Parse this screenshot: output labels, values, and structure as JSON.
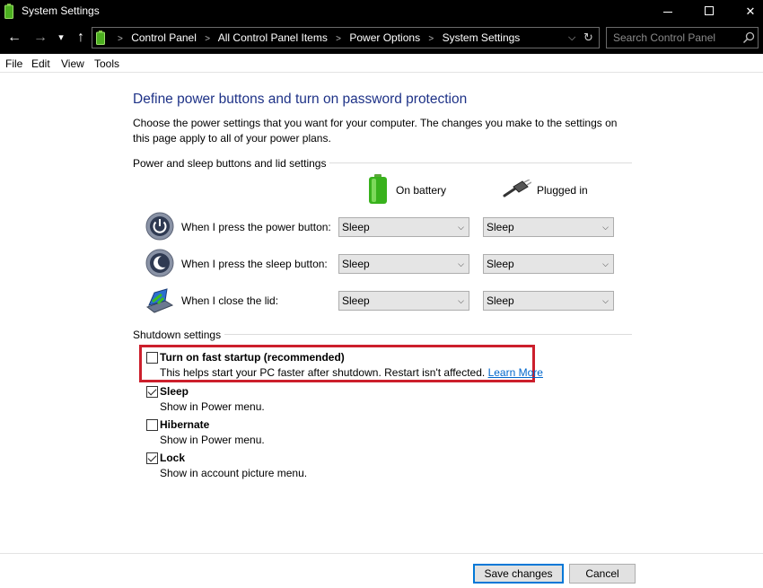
{
  "window": {
    "title": "System Settings",
    "min_icon": "minimize-icon",
    "max_icon": "maximize-icon",
    "close_glyph": "✕"
  },
  "address_bar": {
    "breadcrumbs": [
      "Control Panel",
      "All Control Panel Items",
      "Power Options",
      "System Settings"
    ],
    "search_placeholder": "Search Control Panel"
  },
  "menu": {
    "items": [
      "File",
      "Edit",
      "View",
      "Tools"
    ]
  },
  "content": {
    "heading": "Define power buttons and turn on password protection",
    "description": "Choose the power settings that you want for your computer. The changes you make to the settings on this page apply to all of your power plans.",
    "power_group_label": "Power and sleep buttons and lid settings",
    "columns": {
      "battery": "On battery",
      "plugged": "Plugged in"
    },
    "rows": [
      {
        "label": "When I press the power button:",
        "icon": "power-button-icon",
        "battery": "Sleep",
        "plugged": "Sleep"
      },
      {
        "label": "When I press the sleep button:",
        "icon": "sleep-button-icon",
        "battery": "Sleep",
        "plugged": "Sleep"
      },
      {
        "label": "When I close the lid:",
        "icon": "laptop-lid-icon",
        "battery": "Sleep",
        "plugged": "Sleep"
      }
    ],
    "shutdown_group_label": "Shutdown settings",
    "shutdown_options": [
      {
        "title": "Turn on fast startup (recommended)",
        "desc": "This helps start your PC faster after shutdown. Restart isn't affected.",
        "link": "Learn More",
        "checked": false
      },
      {
        "title": "Sleep",
        "desc": "Show in Power menu.",
        "checked": true
      },
      {
        "title": "Hibernate",
        "desc": "Show in Power menu.",
        "checked": false
      },
      {
        "title": "Lock",
        "desc": "Show in account picture menu.",
        "checked": true
      }
    ]
  },
  "buttons": {
    "save": "Save changes",
    "cancel": "Cancel"
  },
  "colors": {
    "heading": "#1e3287",
    "highlight": "#cc1f2c",
    "link": "#0066cc"
  }
}
